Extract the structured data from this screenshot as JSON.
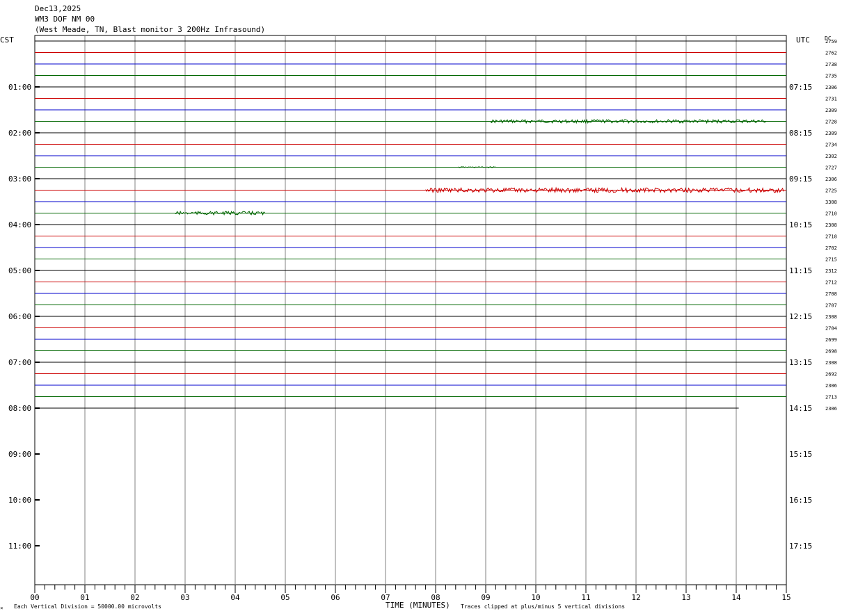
{
  "header": {
    "date": "Dec13,2025",
    "station": "WM3 DOF NM 00",
    "description": "(West Meade, TN, Blast monitor 3 200Hz Infrasound)"
  },
  "left_timezone": "CST",
  "right_timezone": "UTC",
  "dc_header": "DC",
  "footer": {
    "corner_mark": "¤",
    "scale_note": "Each Vertical Division = 50000.00 microvolts",
    "xlabel": "TIME (MINUTES)",
    "clip_note": "Traces clipped at plus/minus 5 vertical divisions"
  },
  "colors": {
    "line_cycle": [
      "#000000",
      "#cc0000",
      "#0000cc",
      "#006600"
    ],
    "grid": "#808080"
  },
  "chart_data": {
    "type": "line",
    "title": "WM3 DOF NM 00",
    "xlabel": "TIME (MINUTES)",
    "xlim": [
      0,
      15
    ],
    "x_ticks": [
      "00",
      "01",
      "02",
      "03",
      "04",
      "05",
      "06",
      "07",
      "08",
      "09",
      "10",
      "11",
      "12",
      "13",
      "14",
      "15"
    ],
    "traces_per_hour": 4,
    "left_hour_labels": [
      "01:00",
      "02:00",
      "03:00",
      "04:00",
      "05:00",
      "06:00",
      "07:00",
      "08:00",
      "09:00",
      "10:00",
      "11:00"
    ],
    "right_hour_labels": [
      "07:15",
      "08:15",
      "09:15",
      "10:15",
      "11:15",
      "12:15",
      "13:15",
      "14:15",
      "15:15",
      "16:15",
      "17:15"
    ],
    "dc_values": [
      "2759",
      "2762",
      "2738",
      "2735",
      "2306",
      "2731",
      "2309",
      "2728",
      "2309",
      "2734",
      "2302",
      "2727",
      "2306",
      "2725",
      "3308",
      "2710",
      "2308",
      "2718",
      "2702",
      "2715",
      "2312",
      "2712",
      "2708",
      "2707",
      "2308",
      "2704",
      "2699",
      "2698",
      "2308",
      "2692",
      "2306",
      "2713",
      "2306"
    ],
    "last_trace_end_minute": 14.05,
    "events": [
      {
        "trace": 7,
        "start_minute": 9.1,
        "end_minute": 14.6,
        "amplitude_divisions": 0.15
      },
      {
        "trace": 11,
        "start_minute": 8.45,
        "end_minute": 9.2,
        "amplitude_divisions": 0.05
      },
      {
        "trace": 13,
        "start_minute": 7.8,
        "end_minute": 14.95,
        "amplitude_divisions": 0.2
      },
      {
        "trace": 15,
        "start_minute": 2.8,
        "end_minute": 4.6,
        "amplitude_divisions": 0.15
      }
    ]
  }
}
